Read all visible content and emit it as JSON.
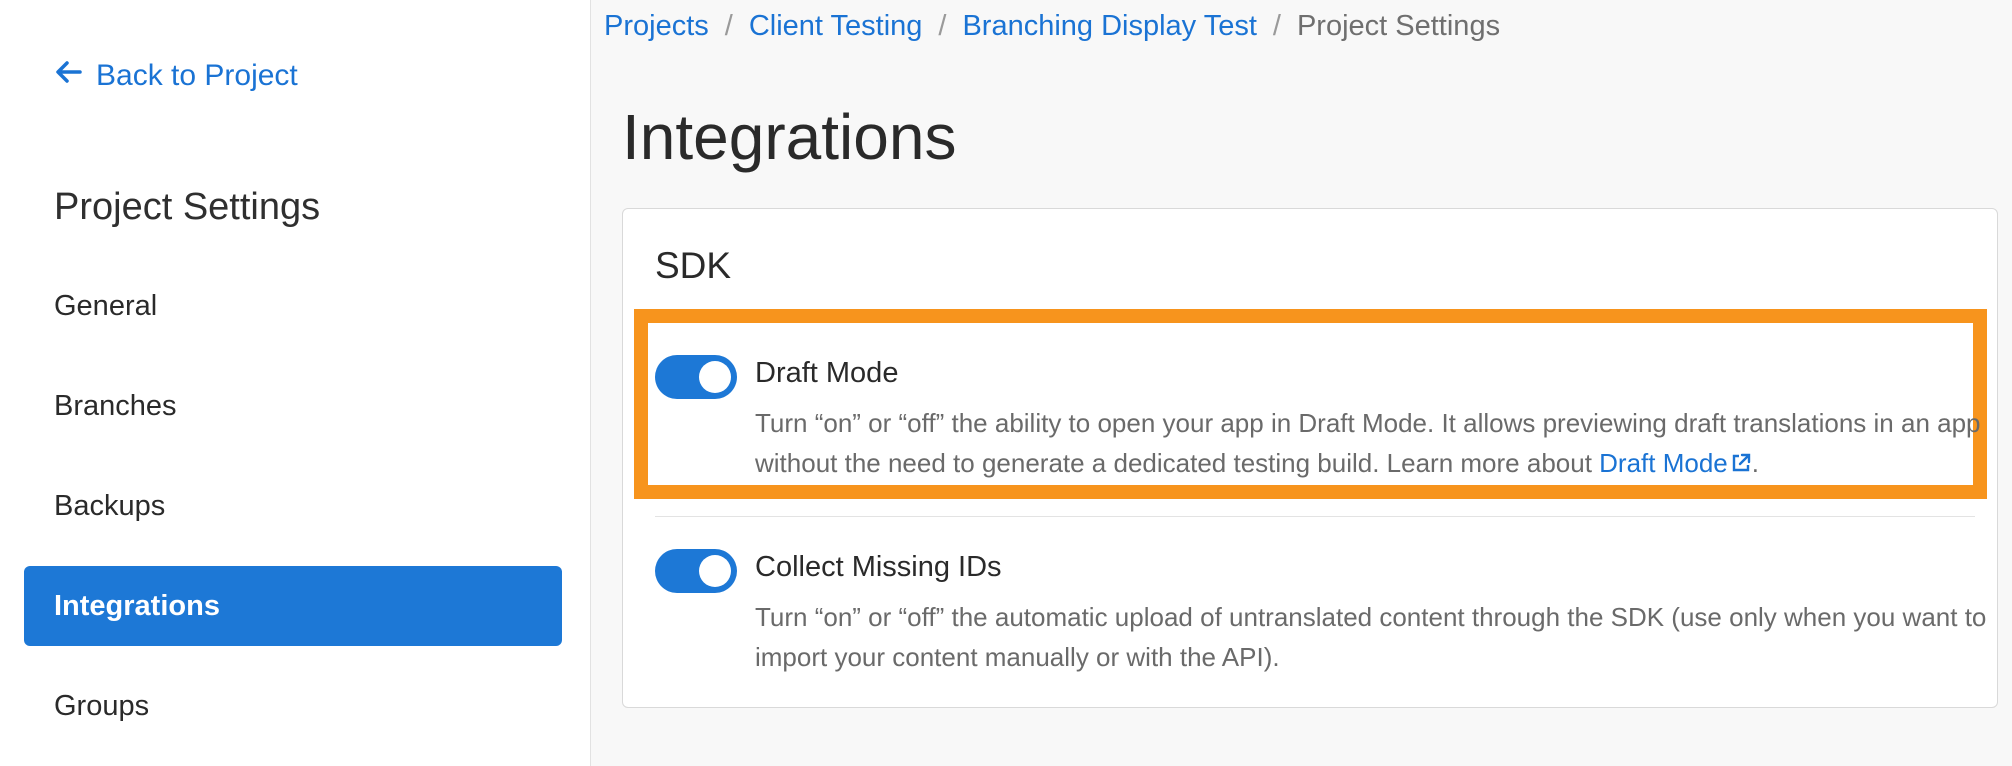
{
  "sidebar": {
    "back_label": "Back to Project",
    "title": "Project Settings",
    "items": [
      {
        "label": "General"
      },
      {
        "label": "Branches"
      },
      {
        "label": "Backups"
      },
      {
        "label": "Integrations"
      },
      {
        "label": "Groups"
      }
    ],
    "active_item": "Integrations"
  },
  "breadcrumb": {
    "items": [
      "Projects",
      "Client Testing",
      "Branching Display Test"
    ],
    "current": "Project Settings"
  },
  "page": {
    "title": "Integrations"
  },
  "card": {
    "title": "SDK",
    "settings": [
      {
        "title": "Draft Mode",
        "enabled": true,
        "description_before_link": "Turn “on” or “off” the ability to open your app in Draft Mode. It allows previewing draft translations in an app without the need to generate a dedicated testing build. Learn more about ",
        "link_text": "Draft Mode",
        "description_after_link": "."
      },
      {
        "title": "Collect Missing IDs",
        "enabled": true,
        "description": "Turn “on” or “off” the automatic upload of untranslated content through the SDK (use only when you want to import your content manually or with the API)."
      }
    ]
  },
  "colors": {
    "accent": "#1d78d6",
    "link": "#1a73d4",
    "highlight": "#f7941d"
  },
  "icons": {
    "back": "arrow-left-icon",
    "external": "external-link-icon"
  }
}
